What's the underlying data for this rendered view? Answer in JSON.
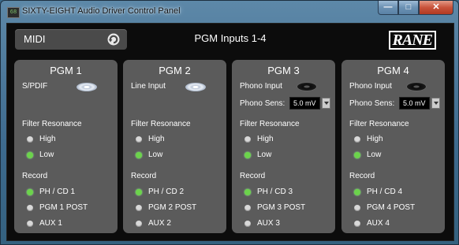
{
  "window": {
    "title": "SIXTY-EIGHT Audio Driver Control Panel",
    "app_icon_text": "68",
    "minimize_glyph": "—",
    "maximize_glyph": "□",
    "close_glyph": "✕"
  },
  "header": {
    "midi_label": "MIDI",
    "midi_icon": "refresh-icon",
    "title": "PGM Inputs 1-4",
    "brand": "RANE"
  },
  "colors": {
    "panel": "#5b5b5b",
    "background": "#0c0c0c",
    "radio_on": "#6cd34b",
    "radio_off": "#d8d8d8"
  },
  "panels": [
    {
      "title": "PGM 1",
      "input": "S/PDIF",
      "input_icon": "cd-icon",
      "filter_label": "Filter Resonance",
      "filter_options": [
        "High",
        "Low"
      ],
      "filter_selected": "Low",
      "record_label": "Record",
      "record_options": [
        "PH / CD 1",
        "PGM 1 POST",
        "AUX 1"
      ],
      "record_selected": "PH / CD 1"
    },
    {
      "title": "PGM 2",
      "input": "Line Input",
      "input_icon": "cd-icon",
      "filter_label": "Filter Resonance",
      "filter_options": [
        "High",
        "Low"
      ],
      "filter_selected": "Low",
      "record_label": "Record",
      "record_options": [
        "PH / CD 2",
        "PGM 2 POST",
        "AUX 2"
      ],
      "record_selected": "PH / CD 2"
    },
    {
      "title": "PGM 3",
      "input": "Phono Input",
      "input_icon": "vinyl-icon",
      "sens_label": "Phono Sens:",
      "sens_value": "5.0 mV",
      "filter_label": "Filter Resonance",
      "filter_options": [
        "High",
        "Low"
      ],
      "filter_selected": "Low",
      "record_label": "Record",
      "record_options": [
        "PH / CD 3",
        "PGM 3 POST",
        "AUX 3"
      ],
      "record_selected": "PH / CD 3"
    },
    {
      "title": "PGM 4",
      "input": "Phono Input",
      "input_icon": "vinyl-icon",
      "sens_label": "Phono Sens:",
      "sens_value": "5.0 mV",
      "filter_label": "Filter Resonance",
      "filter_options": [
        "High",
        "Low"
      ],
      "filter_selected": "Low",
      "record_label": "Record",
      "record_options": [
        "PH / CD 4",
        "PGM 4 POST",
        "AUX 4"
      ],
      "record_selected": "PH / CD 4"
    }
  ]
}
